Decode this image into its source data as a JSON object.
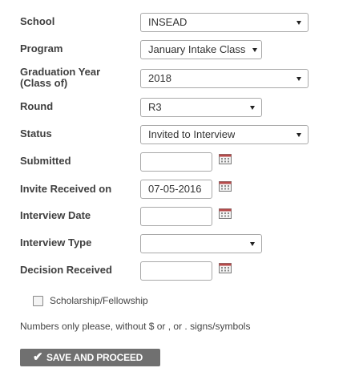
{
  "form": {
    "school": {
      "label": "School",
      "value": "INSEAD"
    },
    "program": {
      "label": "Program",
      "value": "January Intake Class"
    },
    "graduation_year": {
      "label_line1": "Graduation Year",
      "label_line2": "(Class of)",
      "value": "2018"
    },
    "round": {
      "label": "Round",
      "value": "R3"
    },
    "status": {
      "label": "Status",
      "value": "Invited to Interview"
    },
    "submitted": {
      "label": "Submitted",
      "value": ""
    },
    "invite_received": {
      "label": "Invite Received on",
      "value": "07-05-2016"
    },
    "interview_date": {
      "label": "Interview Date",
      "value": ""
    },
    "interview_type": {
      "label": "Interview Type",
      "value": ""
    },
    "decision_received": {
      "label": "Decision Received",
      "value": ""
    },
    "scholarship": {
      "label": "Scholarship/Fellowship",
      "checked": false
    },
    "note": "Numbers only please, without $ or , or . signs/symbols",
    "submit_label": "SAVE AND PROCEED"
  },
  "icons": {
    "calendar": "calendar-icon",
    "dropdown": "chevron-down-icon",
    "check": "checkmark-icon"
  }
}
